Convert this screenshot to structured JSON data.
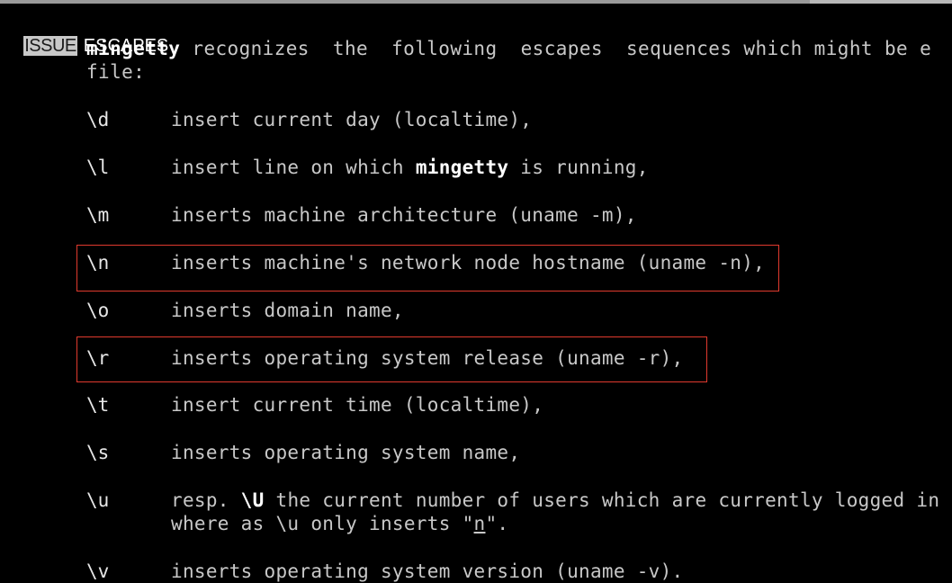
{
  "header": {
    "tag": "ISSUE",
    "title": "ESCAPES"
  },
  "intro": {
    "program": "mingetty",
    "line1_rest": " recognizes  the  following  escapes  sequences which might be e",
    "line2": "file:"
  },
  "escapes": [
    {
      "key": "\\d",
      "desc": "insert current day (localtime),"
    },
    {
      "key": "\\l",
      "desc_pre": "insert line on which ",
      "desc_bold": "mingetty",
      "desc_post": " is running,"
    },
    {
      "key": "\\m",
      "desc": "inserts machine architecture (uname -m),"
    },
    {
      "key": "\\n",
      "desc": "inserts machine's network node hostname (uname -n),"
    },
    {
      "key": "\\o",
      "desc": "inserts domain name,"
    },
    {
      "key": "\\r",
      "desc": "inserts operating system release (uname -r),"
    },
    {
      "key": "\\t",
      "desc": "insert current time (localtime),"
    },
    {
      "key": "\\s",
      "desc": "inserts operating system name,"
    },
    {
      "key": "\\u",
      "desc_pre": "resp. ",
      "desc_bold": "\\U",
      "desc_post": " the current number of users which are currently logged in",
      "desc_line2_pre": "where as \\u only inserts \"",
      "desc_line2_u": "n",
      "desc_line2_post": "\"."
    },
    {
      "key": "\\v",
      "desc": "inserts operating system version (uname -v)."
    }
  ],
  "colors": {
    "background": "#000000",
    "text": "#c8c8c8",
    "highlight_border": "#e03a2e"
  }
}
